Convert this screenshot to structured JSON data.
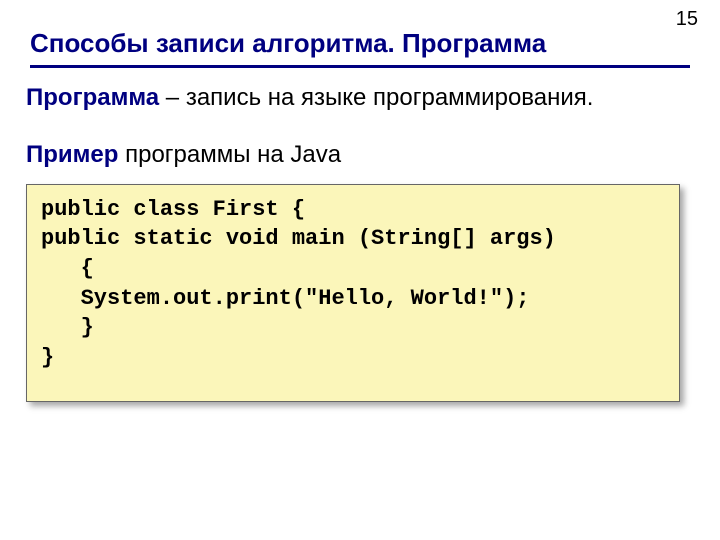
{
  "page_number": "15",
  "title": "Способы записи алгоритма. Программа",
  "definition": {
    "term": "Программа",
    "dash": " – ",
    "desc": "запись на языке программирования."
  },
  "example": {
    "term": "Пример",
    "rest": " программы на Java"
  },
  "code_lines": [
    "public class First {",
    "public static void main (String[] args)",
    "   {",
    "   System.out.print(\"Hello, World!\");",
    "   }",
    "}"
  ]
}
